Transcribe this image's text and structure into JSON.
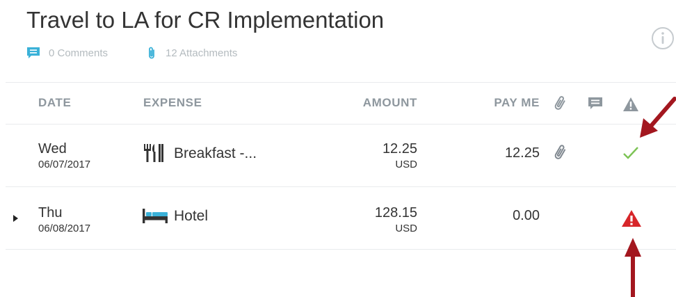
{
  "report": {
    "title": "Travel to LA for CR Implementation",
    "comments_label": "0 Comments",
    "attachments_label": "12 Attachments"
  },
  "table": {
    "headers": {
      "date": "DATE",
      "expense": "EXPENSE",
      "amount": "AMOUNT",
      "pay_me": "PAY ME"
    },
    "rows": [
      {
        "day": "Wed",
        "date": "06/07/2017",
        "expense_icon": "utensils-icon",
        "expense": "Breakfast -...",
        "amount": "12.25",
        "currency": "USD",
        "pay_me": "12.25",
        "has_attachment": true,
        "status": "ok"
      },
      {
        "day": "Thu",
        "date": "06/08/2017",
        "expense_icon": "bed-icon",
        "expense": "Hotel",
        "amount": "128.15",
        "currency": "USD",
        "pay_me": "0.00",
        "has_attachment": false,
        "status": "warning"
      }
    ]
  },
  "colors": {
    "accent": "#3ab1d8",
    "ok": "#7cc354",
    "warning": "#d7262a",
    "annotation_arrow": "#a3171f",
    "header_text": "#8e979e"
  }
}
